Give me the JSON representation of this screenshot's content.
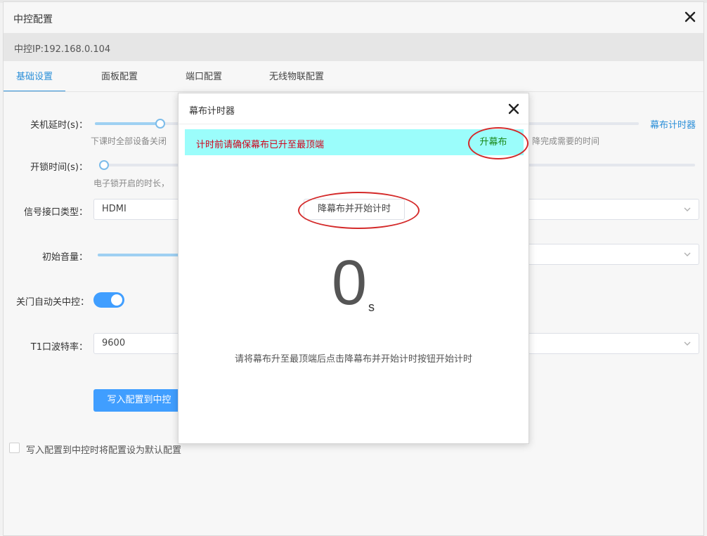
{
  "window": {
    "title": "中控配置"
  },
  "ip": {
    "text": "中控IP:192.168.0.104"
  },
  "tabs": [
    {
      "label": "基础设置",
      "active": true
    },
    {
      "label": "面板配置",
      "active": false
    },
    {
      "label": "端口配置",
      "active": false
    },
    {
      "label": "无线物联配置",
      "active": false
    }
  ],
  "form": {
    "shutdown_delay": {
      "label": "关机延时(s)：",
      "hint": "下课时全部设备关闭",
      "level": 0.12
    },
    "unlock_time": {
      "label": "开锁时间(s)：",
      "hint": "电子锁开启的时长，",
      "level": 0.0
    },
    "signal_type": {
      "label": "信号接口类型：",
      "value": "HDMI"
    },
    "initial_volume": {
      "label": "初始音量："
    },
    "door_auto_off": {
      "label": "关门自动关中控：",
      "on": true
    },
    "t1_baud": {
      "label": "T1口波特率：",
      "value": "9600"
    },
    "write_button": "写入配置到中控",
    "default_checkbox_label": "写入配置到中控时将配置设为默认配置",
    "screen_timer_link": "幕布计时器",
    "screen_hint_tail": "降完成需要的时间"
  },
  "modal": {
    "title": "幕布计时器",
    "alert_text": "计时前请确保幕布已升至最顶端",
    "raise_button": "升幕布",
    "lower_button": "降幕布并开始计时",
    "counter_value": "0",
    "counter_unit": "s",
    "instruction": "请将幕布升至最顶端后点击降幕布并开始计时按钮开始计时"
  },
  "colors": {
    "accent": "#409eff",
    "link": "#2b8fd8",
    "alert_bg": "#9bfdfb",
    "alert_text": "#d0021b",
    "raise_text": "#1a8a1a",
    "annotation": "#d42a2a"
  }
}
